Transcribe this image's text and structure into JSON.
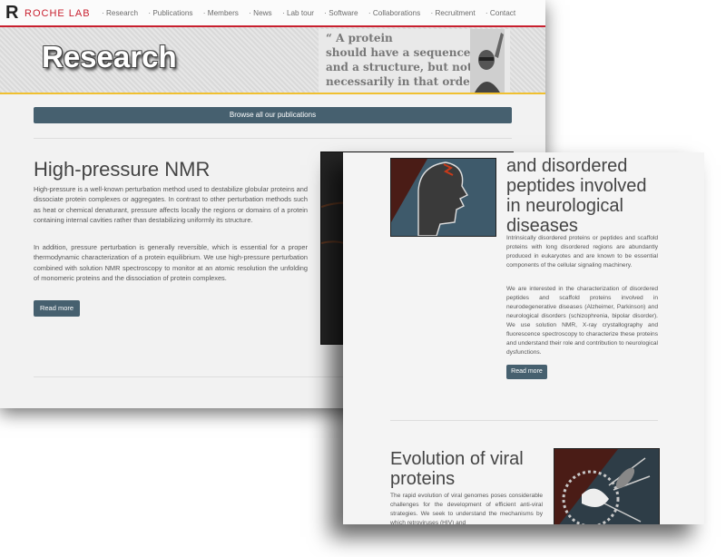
{
  "nav": {
    "logo_mark": "R",
    "logo_text": "ROCHE LAB",
    "links": [
      "· Research",
      "· Publications",
      "· Members",
      "· News",
      "· Lab tour",
      "· Software",
      "· Collaborations",
      "· Recruitment",
      "· Contact"
    ]
  },
  "banner": {
    "title": "Research",
    "quote_lines": [
      "“ A protein",
      "should have a sequence",
      "and a structure, but not",
      "necessarily in that order.”"
    ]
  },
  "browse_label": "Browse all our publications",
  "section_hp": {
    "title": "High-pressure NMR",
    "paragraphs": [
      "High-pressure is a well-known perturbation method used to destabilize globular proteins and dissociate protein complexes or aggregates. In contrast to other perturbation methods such as heat or chemical denaturant, pressure affects locally the regions or domains of a protein containing internal cavities rather than destabilizing uniformly its structure.",
      "In addition, pressure perturbation is generally reversible, which is essential for a proper thermodynamic characterization of a protein equilibrium. We use high-pressure perturbation combined with solution NMR spectroscopy to monitor at an atomic resolution the unfolding of monomeric proteins and the dissociation of protein complexes."
    ],
    "read_more": "Read more"
  },
  "section_disordered": {
    "title_lines": [
      "and disordered",
      "peptides involved",
      "in neurological",
      "diseases"
    ],
    "paragraphs": [
      "Intrinsically disordered proteins or peptides and scaffold proteins with long disordered regions are abundantly produced in eukaryotes and are known to be essential components of the cellular signaling machinery.",
      "We are interested in the characterization of disordered peptides and scaffold proteins involved in neurodegenerative diseases (Alzheimer, Parkinson) and neurological disorders (schizophrenia, bipolar disorder). We use solution NMR, X-ray crystallography and fluorescence spectroscopy to characterize these proteins and understand their role and contribution to neurological dysfunctions."
    ],
    "read_more": "Read more"
  },
  "section_viral": {
    "title": "Evolution of viral proteins",
    "paragraph": "The rapid evolution of viral genomes poses considerable challenges for the development of efficient anti-viral strategies. We seek to understand the mechanisms by which retroviruses (HIV) and"
  },
  "colors": {
    "accent": "#c8202f",
    "button": "#46606f",
    "banner_underline": "#f0c030"
  }
}
